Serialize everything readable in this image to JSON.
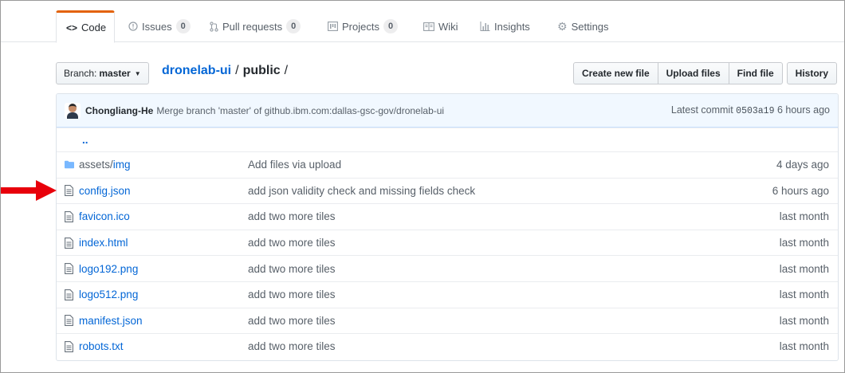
{
  "tabs": [
    {
      "label": "Code",
      "icon": "code-icon",
      "active": true
    },
    {
      "label": "Issues",
      "icon": "issue-icon",
      "count": "0"
    },
    {
      "label": "Pull requests",
      "icon": "pull-request-icon",
      "count": "0"
    },
    {
      "label": "Projects",
      "icon": "project-icon",
      "count": "0"
    },
    {
      "label": "Wiki",
      "icon": "book-icon"
    },
    {
      "label": "Insights",
      "icon": "graph-icon"
    },
    {
      "label": "Settings",
      "icon": "gear-icon"
    }
  ],
  "branch": {
    "prefix": "Branch:",
    "name": "master"
  },
  "breadcrumb": {
    "repo": "dronelab-ui",
    "separator": "/",
    "dir": "public",
    "trailing": "/"
  },
  "actions": {
    "create_file": "Create new file",
    "upload_files": "Upload files",
    "find_file": "Find file",
    "history": "History"
  },
  "commit": {
    "author": "Chongliang-He",
    "message": "Merge branch 'master' of github.ibm.com:dallas-gsc-gov/dronelab-ui",
    "latest_label": "Latest commit",
    "sha": "0503a19",
    "age": "6 hours ago"
  },
  "parent_dir": "..",
  "files": [
    {
      "dir_prefix": "assets/",
      "name": "img",
      "type": "dir",
      "message": "Add files via upload",
      "age": "4 days ago"
    },
    {
      "name": "config.json",
      "type": "file",
      "message": "add json validity check and missing fields check",
      "age": "6 hours ago"
    },
    {
      "name": "favicon.ico",
      "type": "file",
      "message": "add two more tiles",
      "age": "last month"
    },
    {
      "name": "index.html",
      "type": "file",
      "message": "add two more tiles",
      "age": "last month"
    },
    {
      "name": "logo192.png",
      "type": "file",
      "message": "add two more tiles",
      "age": "last month"
    },
    {
      "name": "logo512.png",
      "type": "file",
      "message": "add two more tiles",
      "age": "last month"
    },
    {
      "name": "manifest.json",
      "type": "file",
      "message": "add two more tiles",
      "age": "last month"
    },
    {
      "name": "robots.txt",
      "type": "file",
      "message": "add two more tiles",
      "age": "last month"
    }
  ],
  "colors": {
    "accent_tab": "#e36209",
    "link": "#0366d6",
    "commit_bg": "#f1f8ff",
    "arrow": "#e8000b"
  }
}
